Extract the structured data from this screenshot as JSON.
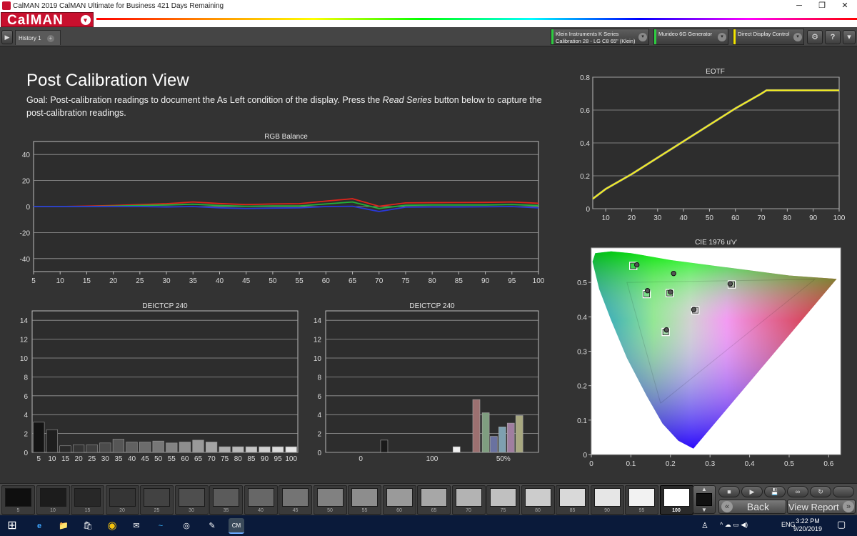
{
  "window": {
    "title": "CalMAN 2019 CalMAN Ultimate for Business 421 Days Remaining",
    "minimize": "─",
    "maximize": "❐",
    "close": "✕"
  },
  "brand": {
    "logo": "CalMAN",
    "logo_caret": "▾"
  },
  "toolbar": {
    "play_icon": "▶",
    "tab_label": "History 1",
    "add_tab": "+",
    "devices": [
      {
        "line1": "Klein Instruments K Series",
        "line2": "Calibration 28 - LG C8 65\" (Klein)",
        "color": "#2ecc40"
      },
      {
        "line1": "Murideo 6G Generator",
        "line2": "",
        "color": "#2ecc40"
      },
      {
        "line1": "Direct Display Control",
        "line2": "",
        "color": "#f3e500"
      }
    ],
    "dropdown_icon": "▾",
    "settings_icon": "⚙",
    "help_icon": "?",
    "window_menu_icon": "▾"
  },
  "page": {
    "heading": "Post Calibration View",
    "goal_prefix": "Goal: Post-calibration readings to document the As Left condition of the display. Press the ",
    "goal_emph": "Read Series",
    "goal_suffix": " button below to capture the post-calibration readings."
  },
  "colors": {
    "red": "#e0241b",
    "green": "#23b23a",
    "blue": "#2a38d8",
    "yellow": "#f5f01e",
    "grid": "#9a9a9a",
    "plot_bg": "#2d2d2d"
  },
  "chart_data": [
    {
      "type": "line",
      "title": "RGB Balance",
      "x": [
        5,
        10,
        15,
        20,
        25,
        30,
        35,
        40,
        45,
        50,
        55,
        60,
        65,
        70,
        75,
        80,
        85,
        90,
        95,
        100
      ],
      "xticks": [
        "5",
        "10",
        "15",
        "20",
        "25",
        "30",
        "35",
        "40",
        "45",
        "50",
        "55",
        "60",
        "65",
        "70",
        "75",
        "80",
        "85",
        "90",
        "95",
        "100"
      ],
      "yticks": [
        "40",
        "20",
        "0",
        "-20",
        "-40"
      ],
      "ylim": [
        -50,
        50
      ],
      "grid": true,
      "series": [
        {
          "color_key": "red",
          "values": [
            0,
            0,
            0.3,
            0.8,
            1.5,
            2.2,
            3.5,
            2.3,
            1.5,
            2.0,
            2.2,
            4.2,
            6.0,
            0.2,
            2.8,
            3.0,
            3.1,
            3.2,
            3.5,
            2.5
          ]
        },
        {
          "color_key": "green",
          "values": [
            0,
            0,
            0,
            0.3,
            0.8,
            1.2,
            1.8,
            0.8,
            0.2,
            0.5,
            0.5,
            2.0,
            3.5,
            -1.5,
            1.0,
            1.2,
            1.2,
            1.2,
            1.5,
            0.8
          ]
        },
        {
          "color_key": "blue",
          "values": [
            0,
            0,
            0,
            0,
            0,
            -0.3,
            0,
            -1.0,
            -1.5,
            -1.2,
            -1.0,
            0,
            0.2,
            -3.8,
            -0.5,
            -0.3,
            -0.3,
            -0.2,
            0,
            -1.0
          ]
        }
      ]
    },
    {
      "type": "line",
      "title": "EOTF",
      "x": [
        5,
        10,
        20,
        30,
        40,
        50,
        60,
        70,
        72,
        80,
        90,
        100
      ],
      "xticks": [
        "10",
        "20",
        "30",
        "40",
        "50",
        "60",
        "70",
        "80",
        "90",
        "100"
      ],
      "yticks": [
        "0.8",
        "0.6",
        "0.4",
        "0.2",
        "0"
      ],
      "xlim": [
        5,
        100
      ],
      "ylim": [
        0,
        0.8
      ],
      "grid": true,
      "series": [
        {
          "color_key": "yellow",
          "values": [
            0.06,
            0.12,
            0.21,
            0.31,
            0.41,
            0.51,
            0.61,
            0.7,
            0.72,
            0.72,
            0.72,
            0.72
          ]
        }
      ]
    },
    {
      "type": "bar",
      "title": "DEICTCP 240",
      "categories": [
        "5",
        "10",
        "15",
        "20",
        "25",
        "30",
        "35",
        "40",
        "45",
        "50",
        "55",
        "60",
        "65",
        "70",
        "75",
        "80",
        "85",
        "90",
        "95",
        "100"
      ],
      "values": [
        3.2,
        2.4,
        0.7,
        0.8,
        0.8,
        1.0,
        1.4,
        1.1,
        1.1,
        1.2,
        1.0,
        1.1,
        1.3,
        1.1,
        0.6,
        0.6,
        0.6,
        0.6,
        0.6,
        0.6
      ],
      "yticks": [
        "14",
        "12",
        "10",
        "8",
        "6",
        "4",
        "2",
        "0"
      ],
      "ylim": [
        0,
        15
      ],
      "grid": true
    },
    {
      "type": "bar",
      "title": "DEICTCP 240",
      "xticks": [
        "0",
        "100",
        "50%"
      ],
      "yticks": [
        "14",
        "12",
        "10",
        "8",
        "6",
        "4",
        "2",
        "0"
      ],
      "ylim": [
        0,
        15
      ],
      "grid": true,
      "bars": [
        {
          "value": 1.3,
          "color": "#1a1a1a"
        },
        {
          "value": 0.6,
          "color": "#f0f0f0"
        },
        {
          "value": 5.6,
          "color": "#9c7070"
        },
        {
          "value": 4.2,
          "color": "#7f9e80"
        },
        {
          "value": 1.7,
          "color": "#6a72a0"
        },
        {
          "value": 2.7,
          "color": "#7ea0b0"
        },
        {
          "value": 3.1,
          "color": "#a07ea0"
        },
        {
          "value": 3.9,
          "color": "#a8a880"
        }
      ]
    },
    {
      "type": "scatter",
      "title": "CIE 1976 u'v'",
      "xticks": [
        "0",
        "0.1",
        "0.2",
        "0.3",
        "0.4",
        "0.5",
        "0.6"
      ],
      "yticks": [
        "0.5",
        "0.4",
        "0.3",
        "0.2",
        "0.1",
        "0"
      ],
      "xlim": [
        0,
        0.63
      ],
      "ylim": [
        0,
        0.6
      ],
      "grid": false,
      "targets": [
        {
          "u": 0.106,
          "v": 0.548
        },
        {
          "u": 0.14,
          "v": 0.466
        },
        {
          "u": 0.198,
          "v": 0.469
        },
        {
          "u": 0.188,
          "v": 0.356
        },
        {
          "u": 0.263,
          "v": 0.419
        },
        {
          "u": 0.355,
          "v": 0.494
        }
      ],
      "measurements": [
        {
          "u": 0.115,
          "v": 0.551
        },
        {
          "u": 0.142,
          "v": 0.476
        },
        {
          "u": 0.2,
          "v": 0.472
        },
        {
          "u": 0.19,
          "v": 0.362
        },
        {
          "u": 0.259,
          "v": 0.421
        },
        {
          "u": 0.351,
          "v": 0.496
        },
        {
          "u": 0.208,
          "v": 0.526
        }
      ]
    }
  ],
  "patches": {
    "labels": [
      "5",
      "10",
      "15",
      "20",
      "25",
      "30",
      "35",
      "40",
      "45",
      "50",
      "55",
      "60",
      "65",
      "70",
      "75",
      "80",
      "85",
      "90",
      "95",
      "100"
    ],
    "selected": "100"
  },
  "controls": {
    "up_icon": "▲",
    "down_icon": "▼",
    "stop_icon": "■",
    "play_icon": "▶",
    "step_icon": "▶▶",
    "save_icon": "💾",
    "loop_icon": "∞",
    "refresh_icon": "↻",
    "back_icon": "«",
    "back_label": "Back",
    "view_report_label": "View Report",
    "forward_icon": "»"
  },
  "taskbar": {
    "start_icon": "⊞",
    "apps": [
      "e",
      "📁",
      "🛍",
      "◉",
      "✉",
      "~",
      "◎",
      "✎",
      "CM"
    ],
    "tray_person": "♙",
    "tray_icons": "^ ☁ ▭ ◀)",
    "language": "ENG",
    "time": "3:22 PM",
    "date": "9/20/2019",
    "notif_icon": "▢"
  }
}
